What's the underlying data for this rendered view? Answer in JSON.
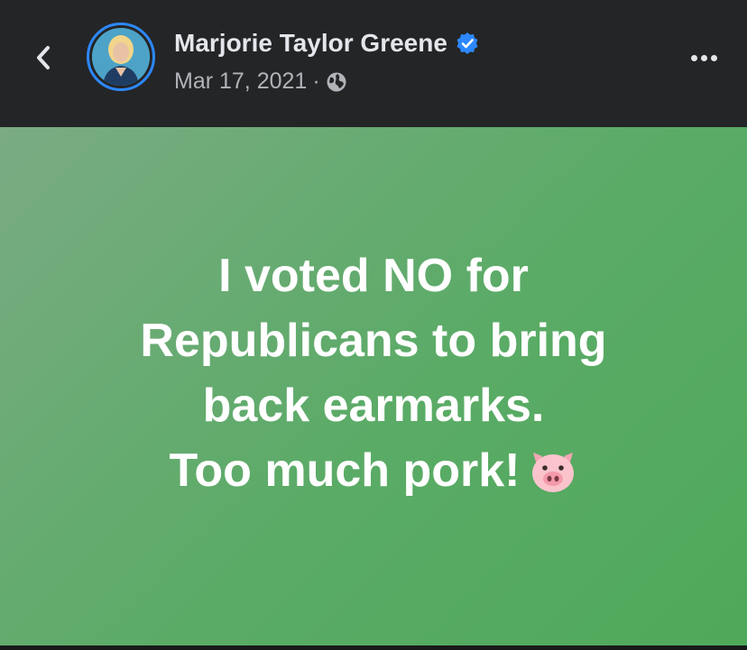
{
  "header": {
    "author_name": "Marjorie Taylor Greene",
    "date": "Mar 17, 2021",
    "separator": "·",
    "icons": {
      "back": "chevron-left-icon",
      "verified": "verified-badge-icon",
      "privacy": "globe-icon",
      "more": "more-horizontal-icon"
    }
  },
  "post": {
    "lines": [
      "I voted NO for",
      "Republicans to bring",
      "back earmarks.",
      "Too much pork!"
    ],
    "emoji": "pig-face-emoji"
  },
  "colors": {
    "header_bg": "#242526",
    "name_text": "#e4e6eb",
    "meta_text": "#b0b3b8",
    "verified_blue": "#2d88ff",
    "post_bg_start": "#7aab83",
    "post_bg_end": "#4fa95a",
    "post_text": "#ffffff"
  }
}
